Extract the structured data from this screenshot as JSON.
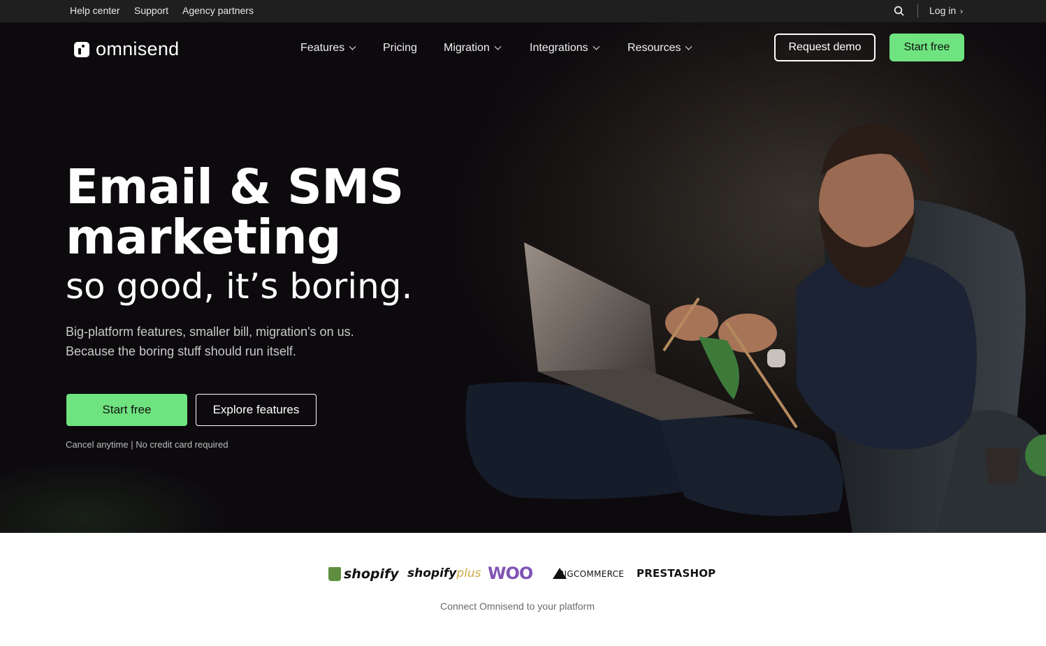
{
  "topbar": {
    "links": [
      "Help center",
      "Support",
      "Agency partners"
    ],
    "login_label": "Log in"
  },
  "nav": {
    "brand": "omnisend",
    "items": [
      {
        "label": "Features",
        "has_dropdown": true
      },
      {
        "label": "Pricing",
        "has_dropdown": false
      },
      {
        "label": "Migration",
        "has_dropdown": true
      },
      {
        "label": "Integrations",
        "has_dropdown": true
      },
      {
        "label": "Resources",
        "has_dropdown": true
      }
    ],
    "request_demo": "Request demo",
    "start_free": "Start free"
  },
  "hero": {
    "headline_line1": "Email & SMS",
    "headline_line2": "marketing",
    "headline_line3": "so good, it’s boring.",
    "subtext_line1": "Big-platform features, smaller bill, migration's on us.",
    "subtext_line2": "Because the boring stuff should run itself.",
    "cta_primary": "Start free",
    "cta_secondary": "Explore features",
    "note": "Cancel anytime | No credit card required"
  },
  "platforms": {
    "logos": [
      {
        "name": "shopify",
        "text": "shopify"
      },
      {
        "name": "shopify-plus",
        "text": "shopify",
        "suffix": "plus"
      },
      {
        "name": "woo",
        "text": "WOO"
      },
      {
        "name": "bigcommerce",
        "text": "BIGCOMMERCE"
      },
      {
        "name": "prestashop",
        "text": "PRESTASHOP"
      }
    ],
    "caption": "Connect Omnisend to your platform"
  },
  "colors": {
    "accent_green": "#6fe37f",
    "hero_bg": "#0d0a0e",
    "topbar_bg": "#1f1f1f",
    "woo_purple": "#7f54b3"
  }
}
